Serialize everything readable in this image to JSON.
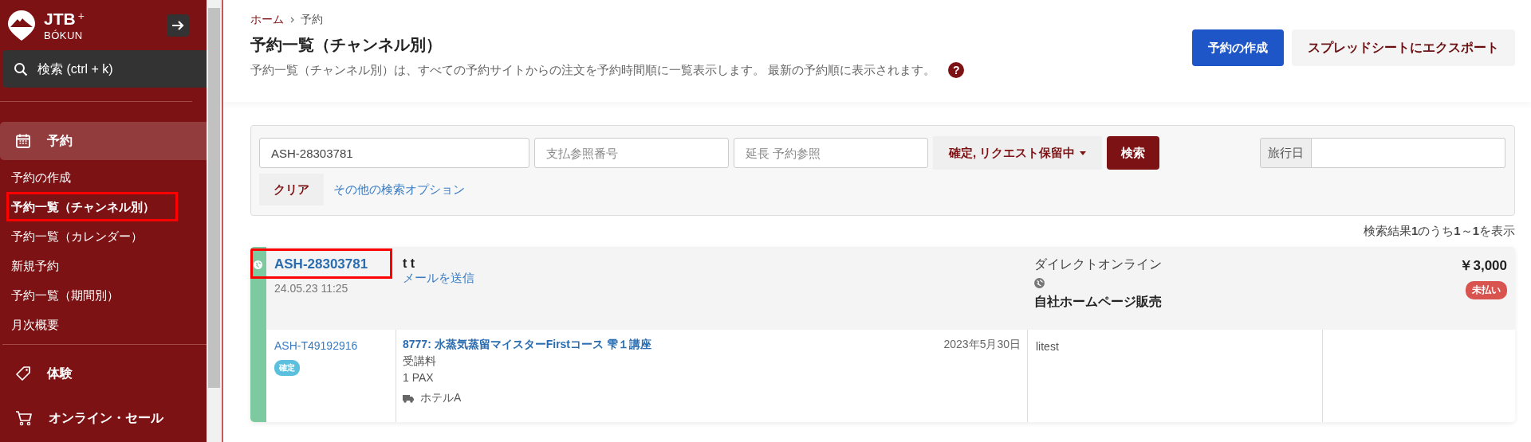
{
  "sidebar": {
    "logo": {
      "brand": "JTB",
      "plus": "+",
      "sub": "BÓKUN"
    },
    "search": {
      "placeholder": "検索 (ctrl + k)"
    },
    "sections": [
      {
        "kind": "calendar",
        "label": "予約",
        "selected": true,
        "items": [
          {
            "label": "予約の作成",
            "selected": false,
            "highlighted": false
          },
          {
            "label": "予約一覧（チャンネル別）",
            "selected": true,
            "highlighted": true
          },
          {
            "label": "予約一覧（カレンダー）",
            "selected": false,
            "highlighted": false
          },
          {
            "label": "新規予約",
            "selected": false,
            "highlighted": false
          },
          {
            "label": "予約一覧（期間別）",
            "selected": false,
            "highlighted": false
          },
          {
            "label": "月次概要",
            "selected": false,
            "highlighted": false
          }
        ]
      },
      {
        "kind": "tag",
        "label": "体験",
        "selected": false
      },
      {
        "kind": "cart",
        "label": "オンライン・セール",
        "selected": false
      }
    ]
  },
  "breadcrumb": [
    "ホーム",
    "予約"
  ],
  "page": {
    "help": "?",
    "title": "予約一覧（チャンネル別）",
    "description": "予約一覧（チャンネル別）は、すべての予約サイトからの注文を予約時間順に一覧表示します。 最新の予約順に表示されます。"
  },
  "actions": [
    {
      "kind": "primary",
      "label": "予約の作成"
    },
    {
      "kind": "secondary",
      "label": "スプレッドシートにエクスポート"
    }
  ],
  "filters": {
    "booking_ref": {
      "value": "ASH-28303781"
    },
    "payment_ref": {
      "placeholder": "支払参照番号"
    },
    "ext_ref": {
      "placeholder": "延長 予約参照"
    },
    "status_dropdown": "確定, リクエスト保留中",
    "search_button": "検索",
    "travel_date": {
      "label": "旅行日"
    },
    "clear_button": "クリア",
    "more_options": "その他の検索オプション"
  },
  "results_summary": "検索結果**1**のうち**1**～**1**を表示",
  "bookings": [
    {
      "id": "ASH-28303781",
      "highlighted": true,
      "color": "#7dc9a0",
      "created": "24.05.23 11:25",
      "customer": "t t",
      "email_link": "メールを送信",
      "channel": "ダイレクトオンライン",
      "channel_label": "自社ホームページ販売",
      "price": "￥3,000",
      "payment_status": "未払い",
      "items": [
        {
          "id": "ASH-T49192916",
          "status": "確定",
          "product": "8777: 水蒸気蒸留マイスターFirstコース 雫１講座",
          "date": "2023年5月30日",
          "rate": "受講料",
          "pax": "1 PAX",
          "pickup": "ホテルA",
          "column_3": "litest"
        }
      ]
    }
  ]
}
